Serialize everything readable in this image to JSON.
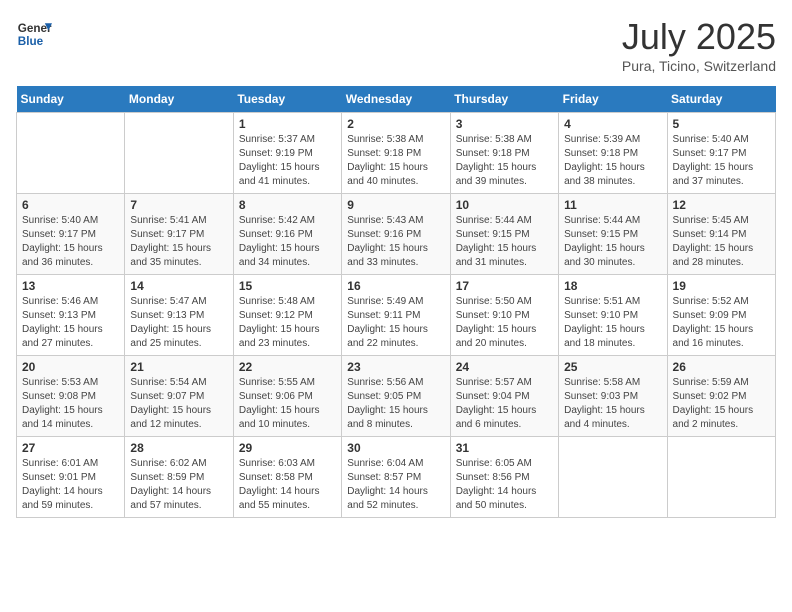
{
  "header": {
    "logo_general": "General",
    "logo_blue": "Blue",
    "month_year": "July 2025",
    "location": "Pura, Ticino, Switzerland"
  },
  "days_of_week": [
    "Sunday",
    "Monday",
    "Tuesday",
    "Wednesday",
    "Thursday",
    "Friday",
    "Saturday"
  ],
  "weeks": [
    [
      {
        "day": "",
        "info": ""
      },
      {
        "day": "",
        "info": ""
      },
      {
        "day": "1",
        "info": "Sunrise: 5:37 AM\nSunset: 9:19 PM\nDaylight: 15 hours\nand 41 minutes."
      },
      {
        "day": "2",
        "info": "Sunrise: 5:38 AM\nSunset: 9:18 PM\nDaylight: 15 hours\nand 40 minutes."
      },
      {
        "day": "3",
        "info": "Sunrise: 5:38 AM\nSunset: 9:18 PM\nDaylight: 15 hours\nand 39 minutes."
      },
      {
        "day": "4",
        "info": "Sunrise: 5:39 AM\nSunset: 9:18 PM\nDaylight: 15 hours\nand 38 minutes."
      },
      {
        "day": "5",
        "info": "Sunrise: 5:40 AM\nSunset: 9:17 PM\nDaylight: 15 hours\nand 37 minutes."
      }
    ],
    [
      {
        "day": "6",
        "info": "Sunrise: 5:40 AM\nSunset: 9:17 PM\nDaylight: 15 hours\nand 36 minutes."
      },
      {
        "day": "7",
        "info": "Sunrise: 5:41 AM\nSunset: 9:17 PM\nDaylight: 15 hours\nand 35 minutes."
      },
      {
        "day": "8",
        "info": "Sunrise: 5:42 AM\nSunset: 9:16 PM\nDaylight: 15 hours\nand 34 minutes."
      },
      {
        "day": "9",
        "info": "Sunrise: 5:43 AM\nSunset: 9:16 PM\nDaylight: 15 hours\nand 33 minutes."
      },
      {
        "day": "10",
        "info": "Sunrise: 5:44 AM\nSunset: 9:15 PM\nDaylight: 15 hours\nand 31 minutes."
      },
      {
        "day": "11",
        "info": "Sunrise: 5:44 AM\nSunset: 9:15 PM\nDaylight: 15 hours\nand 30 minutes."
      },
      {
        "day": "12",
        "info": "Sunrise: 5:45 AM\nSunset: 9:14 PM\nDaylight: 15 hours\nand 28 minutes."
      }
    ],
    [
      {
        "day": "13",
        "info": "Sunrise: 5:46 AM\nSunset: 9:13 PM\nDaylight: 15 hours\nand 27 minutes."
      },
      {
        "day": "14",
        "info": "Sunrise: 5:47 AM\nSunset: 9:13 PM\nDaylight: 15 hours\nand 25 minutes."
      },
      {
        "day": "15",
        "info": "Sunrise: 5:48 AM\nSunset: 9:12 PM\nDaylight: 15 hours\nand 23 minutes."
      },
      {
        "day": "16",
        "info": "Sunrise: 5:49 AM\nSunset: 9:11 PM\nDaylight: 15 hours\nand 22 minutes."
      },
      {
        "day": "17",
        "info": "Sunrise: 5:50 AM\nSunset: 9:10 PM\nDaylight: 15 hours\nand 20 minutes."
      },
      {
        "day": "18",
        "info": "Sunrise: 5:51 AM\nSunset: 9:10 PM\nDaylight: 15 hours\nand 18 minutes."
      },
      {
        "day": "19",
        "info": "Sunrise: 5:52 AM\nSunset: 9:09 PM\nDaylight: 15 hours\nand 16 minutes."
      }
    ],
    [
      {
        "day": "20",
        "info": "Sunrise: 5:53 AM\nSunset: 9:08 PM\nDaylight: 15 hours\nand 14 minutes."
      },
      {
        "day": "21",
        "info": "Sunrise: 5:54 AM\nSunset: 9:07 PM\nDaylight: 15 hours\nand 12 minutes."
      },
      {
        "day": "22",
        "info": "Sunrise: 5:55 AM\nSunset: 9:06 PM\nDaylight: 15 hours\nand 10 minutes."
      },
      {
        "day": "23",
        "info": "Sunrise: 5:56 AM\nSunset: 9:05 PM\nDaylight: 15 hours\nand 8 minutes."
      },
      {
        "day": "24",
        "info": "Sunrise: 5:57 AM\nSunset: 9:04 PM\nDaylight: 15 hours\nand 6 minutes."
      },
      {
        "day": "25",
        "info": "Sunrise: 5:58 AM\nSunset: 9:03 PM\nDaylight: 15 hours\nand 4 minutes."
      },
      {
        "day": "26",
        "info": "Sunrise: 5:59 AM\nSunset: 9:02 PM\nDaylight: 15 hours\nand 2 minutes."
      }
    ],
    [
      {
        "day": "27",
        "info": "Sunrise: 6:01 AM\nSunset: 9:01 PM\nDaylight: 14 hours\nand 59 minutes."
      },
      {
        "day": "28",
        "info": "Sunrise: 6:02 AM\nSunset: 8:59 PM\nDaylight: 14 hours\nand 57 minutes."
      },
      {
        "day": "29",
        "info": "Sunrise: 6:03 AM\nSunset: 8:58 PM\nDaylight: 14 hours\nand 55 minutes."
      },
      {
        "day": "30",
        "info": "Sunrise: 6:04 AM\nSunset: 8:57 PM\nDaylight: 14 hours\nand 52 minutes."
      },
      {
        "day": "31",
        "info": "Sunrise: 6:05 AM\nSunset: 8:56 PM\nDaylight: 14 hours\nand 50 minutes."
      },
      {
        "day": "",
        "info": ""
      },
      {
        "day": "",
        "info": ""
      }
    ]
  ]
}
